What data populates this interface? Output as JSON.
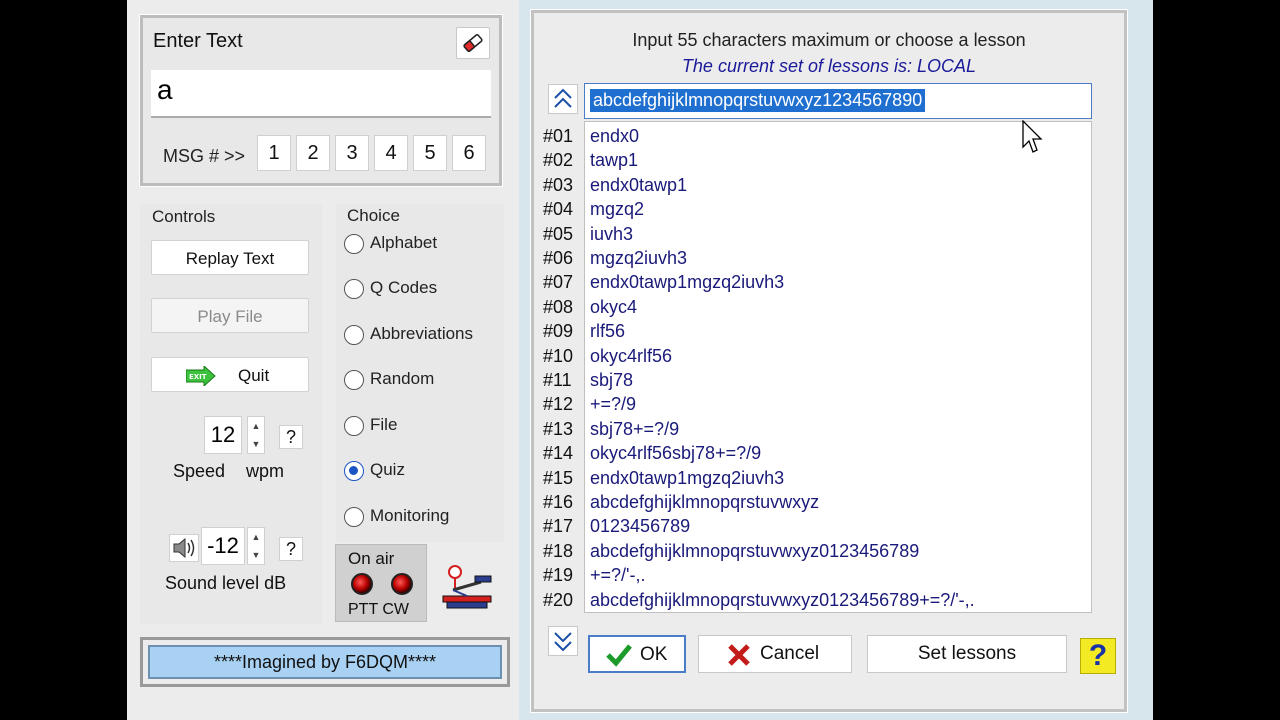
{
  "enter_text": {
    "title": "Enter Text",
    "value": "a",
    "msg_label": "MSG # >>",
    "msg_buttons": [
      "1",
      "2",
      "3",
      "4",
      "5",
      "6"
    ]
  },
  "controls": {
    "title": "Controls",
    "replay_label": "Replay Text",
    "play_file_label": "Play File",
    "quit_label": "Quit",
    "exit_badge": "EXIT",
    "speed_value": "12",
    "speed_label": "Speed",
    "wpm_label": "wpm",
    "sound_value": "-12",
    "sound_label": "Sound level dB",
    "help": "?"
  },
  "choice": {
    "title": "Choice",
    "options": [
      "Alphabet",
      "Q Codes",
      "Abbreviations",
      "Random",
      "File",
      "Quiz",
      "Monitoring"
    ],
    "selected": "Quiz"
  },
  "on_air": {
    "title": "On air",
    "labels": "PTT CW"
  },
  "credit": "****Imagined by F6DQM****",
  "dialog": {
    "title": "Input 55 characters maximum or choose a lesson",
    "subtitle": "The current set of lessons is: LOCAL",
    "input_value": "abcdefghijklmnopqrstuvwxyz1234567890",
    "lessons": [
      {
        "num": "#01",
        "text": "endx0"
      },
      {
        "num": "#02",
        "text": "tawp1"
      },
      {
        "num": "#03",
        "text": "endx0tawp1"
      },
      {
        "num": "#04",
        "text": "mgzq2"
      },
      {
        "num": "#05",
        "text": "iuvh3"
      },
      {
        "num": "#06",
        "text": "mgzq2iuvh3"
      },
      {
        "num": "#07",
        "text": "endx0tawp1mgzq2iuvh3"
      },
      {
        "num": "#08",
        "text": "okyc4"
      },
      {
        "num": "#09",
        "text": "rlf56"
      },
      {
        "num": "#10",
        "text": "okyc4rlf56"
      },
      {
        "num": "#11",
        "text": "sbj78"
      },
      {
        "num": "#12",
        "text": "+=?/9"
      },
      {
        "num": "#13",
        "text": "sbj78+=?/9"
      },
      {
        "num": "#14",
        "text": "okyc4rlf56sbj78+=?/9"
      },
      {
        "num": "#15",
        "text": "endx0tawp1mgzq2iuvh3"
      },
      {
        "num": "#16",
        "text": "abcdefghijklmnopqrstuvwxyz"
      },
      {
        "num": "#17",
        "text": "0123456789"
      },
      {
        "num": "#18",
        "text": "abcdefghijklmnopqrstuvwxyz0123456789"
      },
      {
        "num": "#19",
        "text": "+=?/'-,."
      },
      {
        "num": "#20",
        "text": "abcdefghijklmnopqrstuvwxyz0123456789+=?/'-,."
      }
    ],
    "ok_label": "OK",
    "cancel_label": "Cancel",
    "set_lessons_label": "Set lessons",
    "help": "?"
  },
  "icons": {
    "eraser": "eraser-icon",
    "exit": "exit-icon",
    "speaker": "speaker-icon",
    "morse_key": "morse-key-icon",
    "check": "check-icon",
    "cross": "cross-icon",
    "scroll_up": "chevron-double-up-icon",
    "scroll_down": "chevron-double-down-icon",
    "cursor": "mouse-pointer-icon"
  },
  "colors": {
    "selection": "#1e6fd0",
    "lesson_text": "#1a1a7a",
    "credit_bg": "#a9d1f3",
    "help_yellow": "#f4ea23",
    "radio_selected": "#1b55c4",
    "cancel_red": "#c31a1a",
    "ok_green": "#1d9b2a"
  }
}
